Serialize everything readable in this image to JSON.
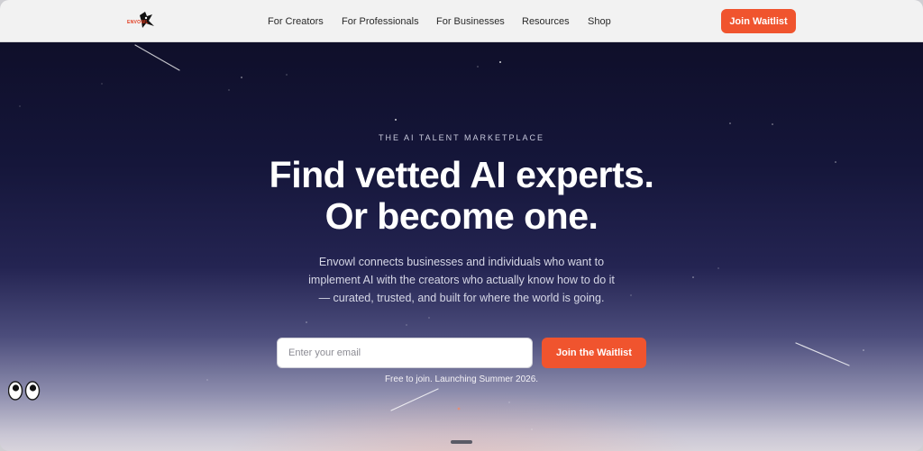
{
  "nav": {
    "brand": "ENVOWL",
    "links": [
      {
        "label": "For Creators"
      },
      {
        "label": "For Professionals"
      },
      {
        "label": "For Businesses"
      },
      {
        "label": "Resources"
      },
      {
        "label": "Shop"
      }
    ],
    "cta_label": "Join Waitlist"
  },
  "hero": {
    "eyebrow": "THE AI TALENT MARKETPLACE",
    "headline_line1": "Find vetted AI experts.",
    "headline_line2": "Or become one.",
    "subtext": "Envowl connects businesses and individuals who want to implement AI with the creators who actually know how to do it — curated, trusted, and built for where the world is going.",
    "email_placeholder": "Enter your email",
    "join_label": "Join the Waitlist",
    "note": "Free to join. Launching Summer 2026."
  },
  "colors": {
    "accent": "#f0542e",
    "nav_bg": "#f2f2f2",
    "hero_top": "#0f0f2a"
  },
  "icons": {
    "logo": "owl-logo-icon",
    "assistant": "eyes-icon"
  }
}
